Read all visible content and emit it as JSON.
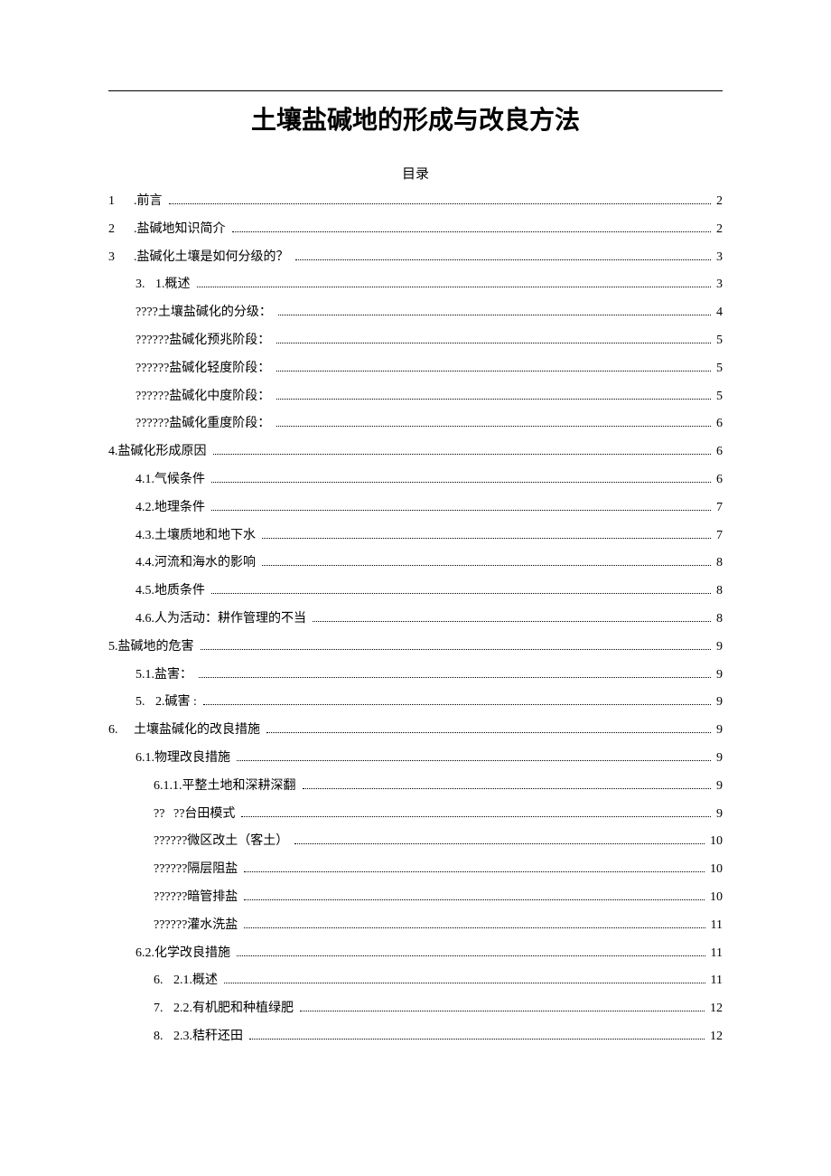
{
  "title": "土壤盐碱地的形成与改良方法",
  "toc_title": "目录",
  "toc": [
    {
      "indent": 0,
      "num": "1",
      "label": ".前言",
      "page": "2"
    },
    {
      "indent": 0,
      "num": "2",
      "label": ".盐碱地知识简介",
      "page": "2"
    },
    {
      "indent": 0,
      "num": "3",
      "label": ".盐碱化土壤是如何分级的？",
      "page": "3"
    },
    {
      "indent": 1,
      "num": "3.",
      "label": "1.概述",
      "page": "3"
    },
    {
      "indent": 1,
      "num": "",
      "label": "????土壤盐碱化的分级：",
      "page": "4"
    },
    {
      "indent": 1,
      "num": "",
      "label": "??????盐碱化预兆阶段：",
      "page": "5"
    },
    {
      "indent": 1,
      "num": "",
      "label": "??????盐碱化轻度阶段：",
      "page": "5"
    },
    {
      "indent": 1,
      "num": "",
      "label": "??????盐碱化中度阶段：",
      "page": "5"
    },
    {
      "indent": 1,
      "num": "",
      "label": "??????盐碱化重度阶段：",
      "page": "6"
    },
    {
      "indent": 0,
      "num": "",
      "label": "4.盐碱化形成原因",
      "page": "6"
    },
    {
      "indent": 1,
      "num": "",
      "label": "4.1.气候条件",
      "page": "6"
    },
    {
      "indent": 1,
      "num": "",
      "label": "4.2.地理条件",
      "page": "7"
    },
    {
      "indent": 1,
      "num": "",
      "label": "4.3.土壤质地和地下水",
      "page": "7"
    },
    {
      "indent": 1,
      "num": "",
      "label": "4.4.河流和海水的影响",
      "page": "8"
    },
    {
      "indent": 1,
      "num": "",
      "label": "4.5.地质条件",
      "page": "8"
    },
    {
      "indent": 1,
      "num": "",
      "label": "4.6.人为活动：耕作管理的不当",
      "page": "8"
    },
    {
      "indent": 0,
      "num": "",
      "label": "5.盐碱地的危害",
      "page": "9"
    },
    {
      "indent": 1,
      "num": "",
      "label": "5.1.盐害：",
      "page": "9"
    },
    {
      "indent": 1,
      "num": "5.",
      "label": "2.碱害 :",
      "page": "9"
    },
    {
      "indent": 0,
      "num": "6.",
      "label": "土壤盐碱化的改良措施",
      "page": "9"
    },
    {
      "indent": 1,
      "num": "",
      "label": "6.1.物理改良措施",
      "page": "9"
    },
    {
      "indent": 2,
      "num": "",
      "label": "6.1.1.平整土地和深耕深翻",
      "page": "9"
    },
    {
      "indent": 2,
      "num": "??",
      "label": "??台田模式",
      "page": "9"
    },
    {
      "indent": 2,
      "num": "",
      "label": "??????微区改土（客土）",
      "page": "10"
    },
    {
      "indent": 2,
      "num": "",
      "label": "??????隔层阻盐",
      "page": "10"
    },
    {
      "indent": 2,
      "num": "",
      "label": "??????暗管排盐",
      "page": "10"
    },
    {
      "indent": 2,
      "num": "",
      "label": "??????灌水洗盐",
      "page": "11"
    },
    {
      "indent": 1,
      "num": "",
      "label": "6.2.化学改良措施",
      "page": "11"
    },
    {
      "indent": 2,
      "num": "6.",
      "label": "2.1.概述",
      "page": "11"
    },
    {
      "indent": 2,
      "num": "7.",
      "label": "2.2.有机肥和种植绿肥",
      "page": "12"
    },
    {
      "indent": 2,
      "num": "8.",
      "label": "2.3.秸秆还田",
      "page": "12"
    }
  ]
}
